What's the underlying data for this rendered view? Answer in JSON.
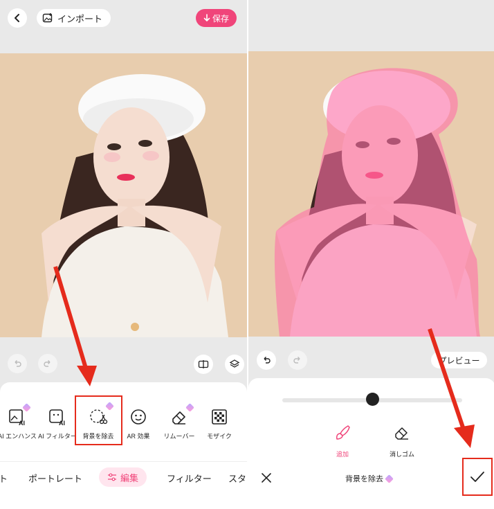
{
  "left": {
    "top_bar": {
      "import_label": "インポート",
      "save_label": "保存"
    },
    "tools": [
      {
        "label": "AI エンハンス",
        "icon": "ai-enhance-icon",
        "premium": true
      },
      {
        "label": "AI フィルター",
        "icon": "ai-filter-icon",
        "premium": false
      },
      {
        "label": "背景を除去",
        "icon": "remove-background-icon",
        "premium": true
      },
      {
        "label": "AR 効果",
        "icon": "ar-effect-icon",
        "premium": false
      },
      {
        "label": "リムーバー",
        "icon": "eraser-icon",
        "premium": true
      },
      {
        "label": "モザイク",
        "icon": "mosaic-icon",
        "premium": false
      }
    ],
    "tabs": [
      "ト",
      "ポートレート",
      "編集",
      "フィルター",
      "スタ"
    ],
    "active_tab": "編集"
  },
  "right": {
    "preview_label": "プレビュー",
    "brush_tools": [
      {
        "label": "追加",
        "icon": "brush-icon",
        "active": true
      },
      {
        "label": "消しゴム",
        "icon": "eraser-icon",
        "active": false
      }
    ],
    "slider_value": 0.5,
    "title": "背景を除去"
  },
  "colors": {
    "accent": "#f0457a",
    "annotation": "#e52b1c",
    "mask": "#ff6fa8"
  }
}
